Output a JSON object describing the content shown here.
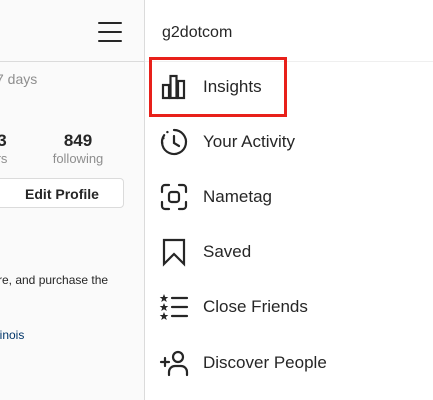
{
  "profile": {
    "days_text": "7 days",
    "stats": [
      {
        "number": "3",
        "label": "rs"
      },
      {
        "number": "849",
        "label": "following"
      }
    ],
    "edit_profile_label": "Edit Profile",
    "bio_text": "re, and purchase the",
    "location_text": "linois"
  },
  "menu": {
    "username": "g2dotcom",
    "items": [
      {
        "label": "Insights",
        "icon": "bar-chart-icon"
      },
      {
        "label": "Your Activity",
        "icon": "activity-clock-icon"
      },
      {
        "label": "Nametag",
        "icon": "nametag-scan-icon"
      },
      {
        "label": "Saved",
        "icon": "bookmark-icon"
      },
      {
        "label": "Close Friends",
        "icon": "star-list-icon"
      },
      {
        "label": "Discover People",
        "icon": "add-person-icon"
      }
    ]
  },
  "colors": {
    "highlight": "#e8201a",
    "text": "#262626",
    "muted": "#8e8e8e",
    "link": "#003569"
  }
}
